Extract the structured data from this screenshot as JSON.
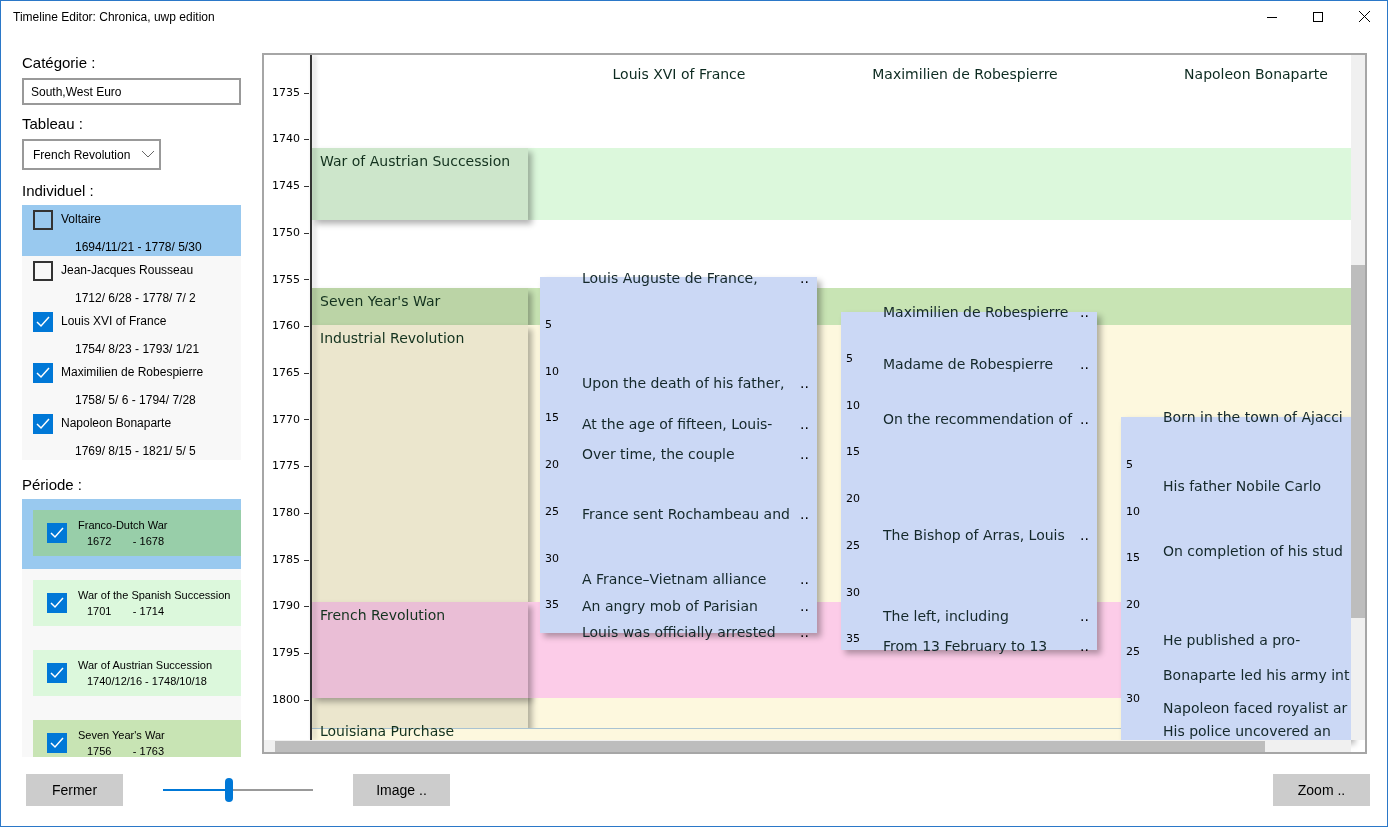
{
  "window": {
    "title": "Timeline Editor: Chronica, uwp edition"
  },
  "category": {
    "label": "Catégorie :",
    "value": "South,West Euro"
  },
  "tableau": {
    "label": "Tableau :",
    "value": "French Revolution"
  },
  "individuals": {
    "label": "Individuel :",
    "items": [
      {
        "name": "Voltaire",
        "dates": "1694/11/21 - 1778/ 5/30",
        "checked": false,
        "selected": true
      },
      {
        "name": "Jean-Jacques Rousseau",
        "dates": "1712/ 6/28 - 1778/ 7/ 2",
        "checked": false,
        "selected": false
      },
      {
        "name": "Louis XVI of France",
        "dates": "1754/ 8/23 - 1793/ 1/21",
        "checked": true,
        "selected": false
      },
      {
        "name": "Maximilien de Robespierre",
        "dates": "1758/ 5/ 6 - 1794/ 7/28",
        "checked": true,
        "selected": false
      },
      {
        "name": "Napoleon Bonaparte",
        "dates": "1769/ 8/15 - 1821/ 5/ 5",
        "checked": true,
        "selected": false
      }
    ]
  },
  "periods": {
    "label": "Période :",
    "items": [
      {
        "name": "Franco-Dutch War",
        "dates": "1672       - 1678",
        "color": "#98cea9",
        "checked": true,
        "selected": true
      },
      {
        "name": "War of the Spanish Succession",
        "dates": "1701       - 1714",
        "color": "#dcf8dc",
        "checked": true,
        "selected": false
      },
      {
        "name": "War of Austrian Succession",
        "dates": "1740/12/16 - 1748/10/18",
        "color": "#dcf8dc",
        "checked": true,
        "selected": false
      },
      {
        "name": "Seven Year's War",
        "dates": "1756       - 1763",
        "color": "#c8e4b4",
        "checked": true,
        "selected": false
      }
    ]
  },
  "timeline": {
    "axis_ticks": [
      "1735",
      "1740",
      "1745",
      "1750",
      "1755",
      "1760",
      "1765",
      "1770",
      "1775",
      "1780",
      "1785",
      "1790",
      "1795",
      "1800"
    ],
    "bands": [
      {
        "label": "War of Austrian Succession",
        "color": "#dcf8dc"
      },
      {
        "label": "Seven Year's War",
        "color": "#c8e4b4"
      },
      {
        "label": "Industrial Revolution",
        "color": "#fdf8de"
      },
      {
        "label": "French Revolution",
        "color": "#fccce8"
      },
      {
        "label": "Louisiana Purchase",
        "color": "#fdf8de"
      }
    ],
    "columns": [
      {
        "name": "Louis XVI of France",
        "line_numbers": [
          "5",
          "10",
          "15",
          "20",
          "25",
          "30",
          "35"
        ],
        "entries": [
          {
            "text": "Louis Auguste de France,",
            "more": ".."
          },
          {
            "text": "Upon the death of his father,",
            "more": ".."
          },
          {
            "text": "At the age of fifteen, Louis-",
            "more": ".."
          },
          {
            "text": "Over time, the couple",
            "more": ".."
          },
          {
            "text": "France sent Rochambeau and",
            "more": ".."
          },
          {
            "text": "A France–Vietnam alliance",
            "more": ".."
          },
          {
            "text": "An angry mob of Parisian",
            "more": ".."
          },
          {
            "text": "Louis was officially arrested",
            "more": ".."
          }
        ]
      },
      {
        "name": "Maximilien de Robespierre",
        "line_numbers": [
          "5",
          "10",
          "15",
          "20",
          "25",
          "30",
          "35"
        ],
        "entries": [
          {
            "text": "Maximilien de Robespierre",
            "more": ".."
          },
          {
            "text": "Madame de Robespierre",
            "more": ".."
          },
          {
            "text": "On the recommendation of",
            "more": ".."
          },
          {
            "text": "The Bishop of Arras, Louis",
            "more": ".."
          },
          {
            "text": "The left, including",
            "more": ".."
          },
          {
            "text": "From 13 February to 13",
            "more": ".."
          }
        ]
      },
      {
        "name": "Napoleon Bonaparte",
        "line_numbers": [
          "5",
          "10",
          "15",
          "20",
          "25",
          "30"
        ],
        "entries": [
          {
            "text": "Born in the town of Ajacci"
          },
          {
            "text": "His father Nobile Carlo"
          },
          {
            "text": "On completion of his stud"
          },
          {
            "text": "He published a pro-"
          },
          {
            "text": "Bonaparte led his army int"
          },
          {
            "text": "Napoleon faced royalist ar"
          },
          {
            "text": "His police uncovered an"
          }
        ]
      }
    ]
  },
  "footer": {
    "close": "Fermer",
    "zoom_slider": {
      "level": 0.44
    },
    "image": "Image ..",
    "zoom": "Zoom .."
  }
}
